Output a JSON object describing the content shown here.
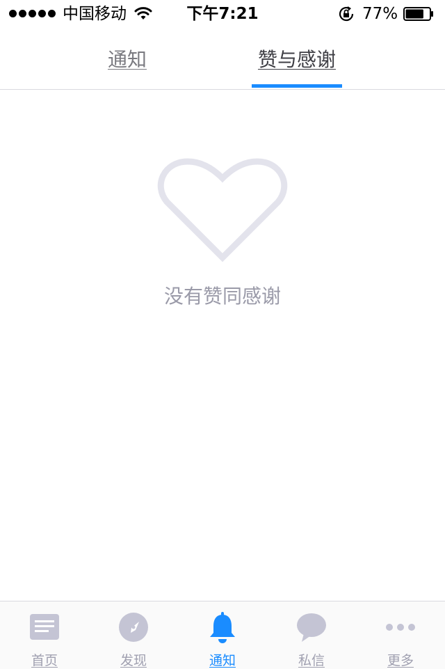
{
  "status_bar": {
    "carrier": "中国移动",
    "time": "下午7:21",
    "battery_percent": "77%",
    "battery_level": 0.77,
    "signal_bars": 5,
    "icons": [
      "signal-dots-icon",
      "wifi-icon",
      "rotation-lock-icon",
      "battery-icon"
    ]
  },
  "tabs": [
    {
      "label": "通知",
      "active": false
    },
    {
      "label": "赞与感谢",
      "active": true
    }
  ],
  "empty_state": {
    "icon": "heart-outline-icon",
    "message": "没有赞同感谢"
  },
  "bottom_nav": [
    {
      "label": "首页",
      "icon": "home-feed-icon",
      "active": false
    },
    {
      "label": "发现",
      "icon": "compass-icon",
      "active": false
    },
    {
      "label": "通知",
      "icon": "bell-icon",
      "active": true
    },
    {
      "label": "私信",
      "icon": "chat-bubble-icon",
      "active": false
    },
    {
      "label": "更多",
      "icon": "more-dots-icon",
      "active": false
    }
  ],
  "colors": {
    "accent": "#1a8cff",
    "inactive_icon": "#c4c4d4",
    "muted_text": "#9a9aa8",
    "divider": "#d9d9df"
  }
}
